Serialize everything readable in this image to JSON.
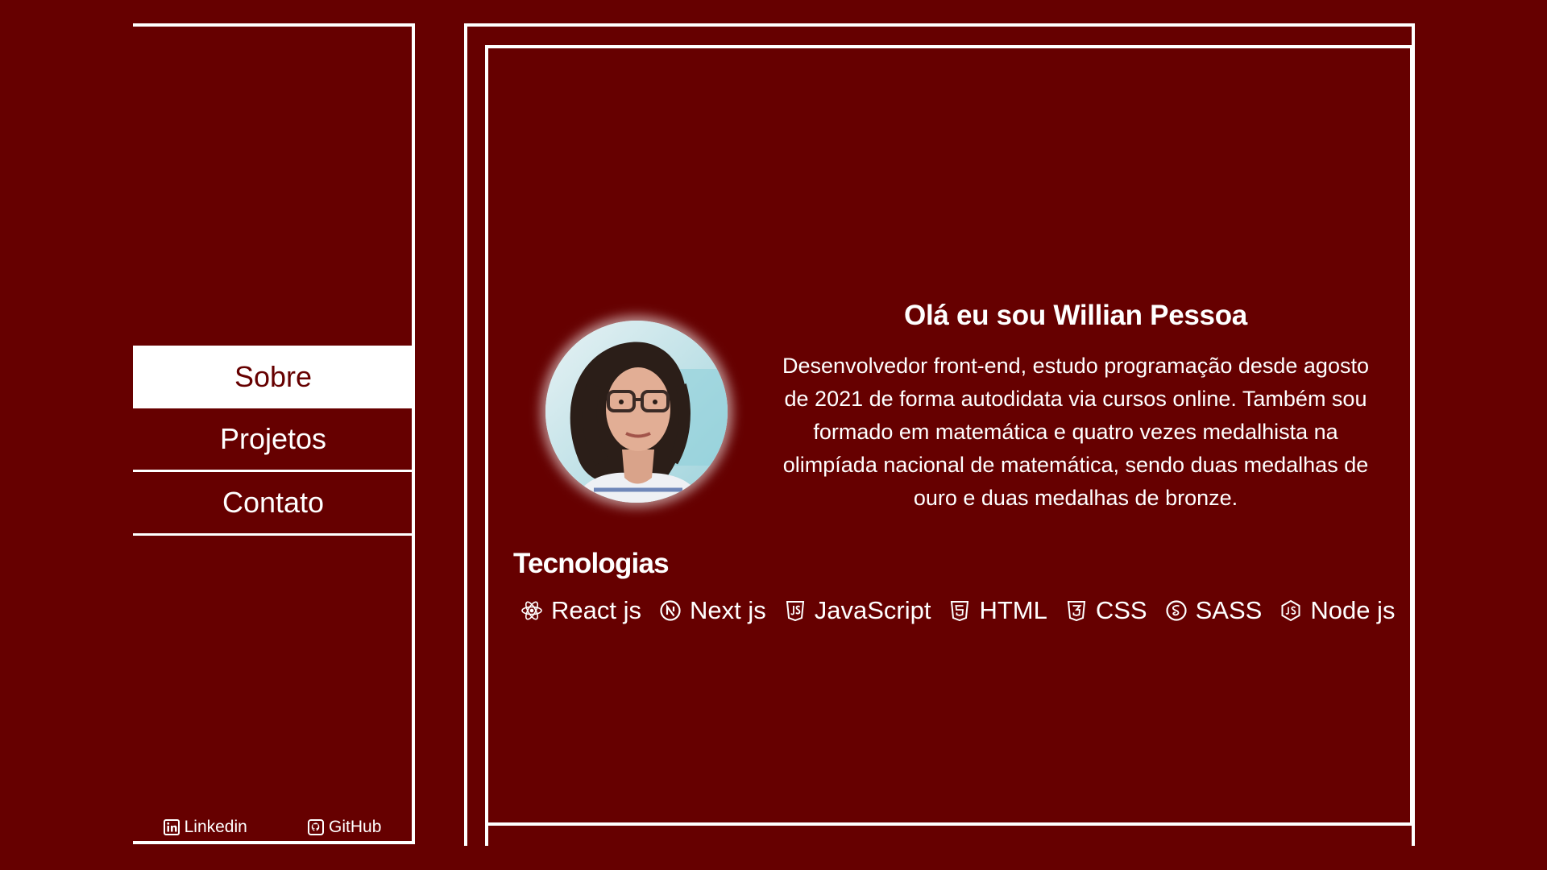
{
  "nav": {
    "items": [
      {
        "label": "Sobre",
        "active": true
      },
      {
        "label": "Projetos",
        "active": false
      },
      {
        "label": "Contato",
        "active": false
      }
    ]
  },
  "social": {
    "linkedin": {
      "label": "Linkedin",
      "icon": "linkedin-icon"
    },
    "github": {
      "label": "GitHub",
      "icon": "github-icon"
    }
  },
  "about": {
    "title": "Olá eu sou Willian Pessoa",
    "description": "Desenvolvedor front-end, estudo programação desde agosto de 2021 de forma autodidata via cursos online. Também sou formado em matemática e quatro vezes medalhista na olimpíada nacional de matemática, sendo duas medalhas de ouro e duas medalhas de bronze."
  },
  "technologies": {
    "title": "Tecnologias",
    "items": [
      {
        "label": "React js",
        "icon": "react-icon"
      },
      {
        "label": "Next js",
        "icon": "nextjs-icon"
      },
      {
        "label": "JavaScript",
        "icon": "javascript-icon"
      },
      {
        "label": "HTML",
        "icon": "html5-icon"
      },
      {
        "label": "CSS",
        "icon": "css3-icon"
      },
      {
        "label": "SASS",
        "icon": "sass-icon"
      },
      {
        "label": "Node js",
        "icon": "nodejs-icon"
      }
    ]
  },
  "colors": {
    "background": "#660000",
    "foreground": "#ffffff"
  }
}
